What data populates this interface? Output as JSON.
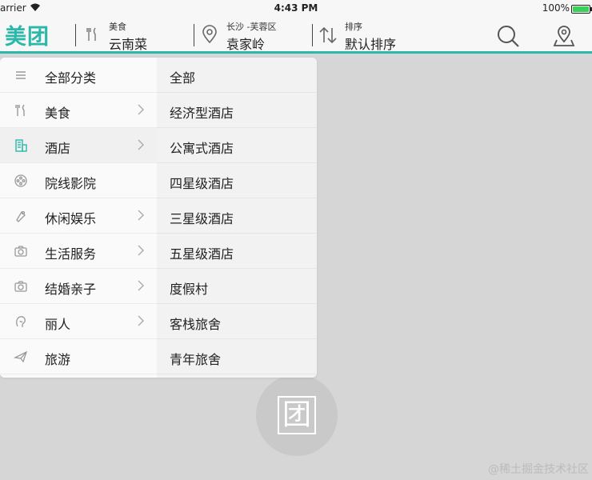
{
  "status_bar": {
    "carrier": "arrier",
    "time": "4:43 PM",
    "battery": "100%"
  },
  "nav": {
    "logo": "美团",
    "category": {
      "small": "美食",
      "big": "云南菜"
    },
    "location": {
      "small": "长沙 -芙蓉区",
      "big": "袁家岭"
    },
    "sort": {
      "small": "排序",
      "big": "默认排序"
    }
  },
  "dropdown": {
    "categories": [
      {
        "label": "全部分类",
        "icon": "list-icon",
        "chevron": false
      },
      {
        "label": "美食",
        "icon": "utensils-icon",
        "chevron": true
      },
      {
        "label": "酒店",
        "icon": "building-icon",
        "chevron": true,
        "selected": true
      },
      {
        "label": "院线影院",
        "icon": "film-reel-icon",
        "chevron": false
      },
      {
        "label": "休闲娱乐",
        "icon": "leisure-icon",
        "chevron": true
      },
      {
        "label": "生活服务",
        "icon": "camera-icon",
        "chevron": true
      },
      {
        "label": "结婚亲子",
        "icon": "camera-icon",
        "chevron": true
      },
      {
        "label": "丽人",
        "icon": "beauty-icon",
        "chevron": true
      },
      {
        "label": "旅游",
        "icon": "plane-icon",
        "chevron": false
      }
    ],
    "subcategories": [
      "全部",
      "经济型酒店",
      "公寓式酒店",
      "四星级酒店",
      "三星级酒店",
      "五星级酒店",
      "度假村",
      "客栈旅舍",
      "青年旅舍"
    ]
  },
  "background": {
    "logo_char": "团",
    "watermark": "@稀土掘金技术社区"
  },
  "colors": {
    "accent": "#2bb8aa",
    "selected_icon": "#2bb8aa"
  }
}
